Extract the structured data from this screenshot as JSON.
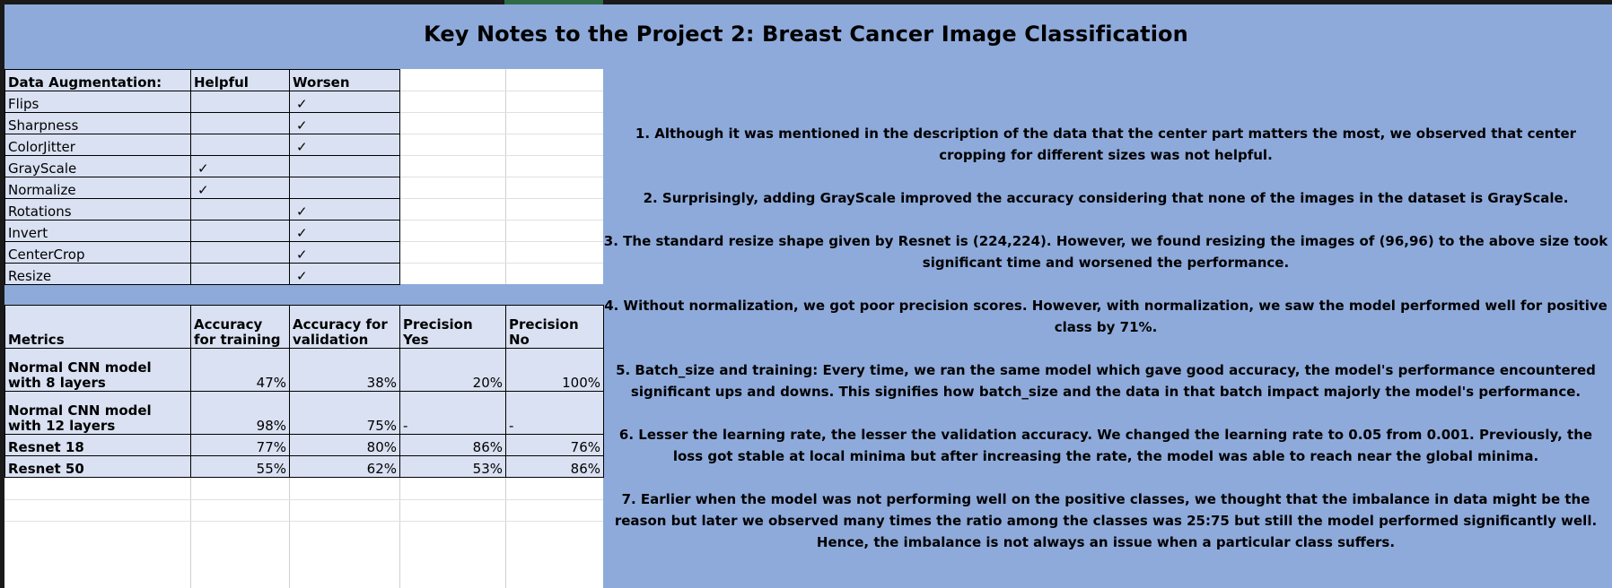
{
  "title": "Key Notes to the Project 2: Breast Cancer Image Classification",
  "check_symbol": "✓",
  "augmentation": {
    "header": [
      "Data Augmentation:",
      "Helpful",
      "Worsen"
    ],
    "rows": [
      {
        "name": "Flips",
        "helpful": "",
        "worsen": "✓"
      },
      {
        "name": "Sharpness",
        "helpful": "",
        "worsen": "✓"
      },
      {
        "name": "ColorJitter",
        "helpful": "",
        "worsen": "✓"
      },
      {
        "name": "GrayScale",
        "helpful": "✓",
        "worsen": ""
      },
      {
        "name": "Normalize",
        "helpful": "✓",
        "worsen": ""
      },
      {
        "name": "Rotations",
        "helpful": "",
        "worsen": "✓"
      },
      {
        "name": "Invert",
        "helpful": "",
        "worsen": "✓"
      },
      {
        "name": "CenterCrop",
        "helpful": "",
        "worsen": "✓"
      },
      {
        "name": "Resize",
        "helpful": "",
        "worsen": "✓"
      }
    ]
  },
  "metrics": {
    "header": [
      "Metrics",
      "Accuracy for training",
      "Accuracy for validation",
      "Precision Yes",
      "Precision No"
    ],
    "rows": [
      {
        "model": "Normal CNN model with 8 layers",
        "train": "47%",
        "val": "38%",
        "prec_yes": "20%",
        "prec_no": "100%"
      },
      {
        "model": "Normal CNN model with 12 layers",
        "train": "98%",
        "val": "75%",
        "prec_yes": "-",
        "prec_no": "-"
      },
      {
        "model": "Resnet 18",
        "train": "77%",
        "val": "80%",
        "prec_yes": "86%",
        "prec_no": "76%"
      },
      {
        "model": "Resnet 50",
        "train": "55%",
        "val": "62%",
        "prec_yes": "53%",
        "prec_no": "86%"
      }
    ]
  },
  "notes": [
    "1. Although it was mentioned in the description of the data that the center part matters the most, we observed that center cropping for different sizes was not helpful.",
    "2. Surprisingly, adding GrayScale improved the accuracy considering that none of the images in the dataset is GrayScale.",
    "3. The standard resize shape given by Resnet is (224,224). However, we found resizing the images of (96,96) to the above size took significant time and worsened the performance.",
    "4. Without normalization, we got poor precision scores. However, with normalization, we saw the model performed well for positive class by 71%.",
    "5. Batch_size and training: Every time, we ran the same model which gave good accuracy, the model's performance encountered significant ups and downs. This signifies how batch_size and the data in that batch impact majorly the model's performance.",
    "6. Lesser the learning rate, the lesser the validation accuracy. We changed the learning rate to 0.05 from 0.001. Previously, the loss got stable at local minima but after increasing the rate, the model was able to reach near the global minima.",
    "7. Earlier when the model was not performing well on the positive classes, we thought that the imbalance in data might be the reason but later we observed many times the ratio among the classes was 25:75 but still the model performed significantly well. Hence, the imbalance is not always an issue when a particular class suffers."
  ]
}
